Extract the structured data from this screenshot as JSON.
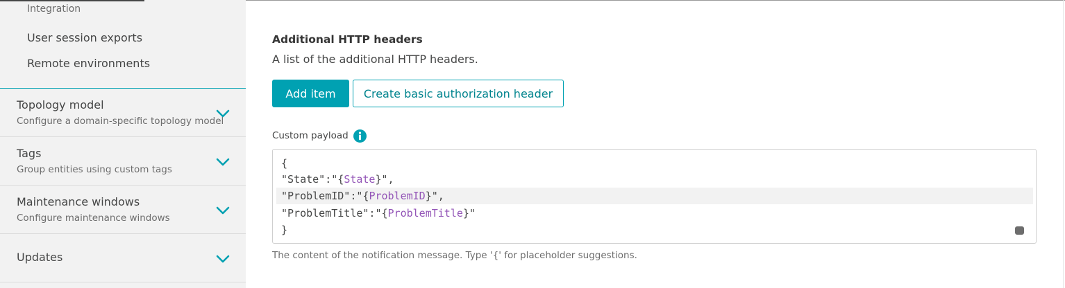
{
  "sidebar": {
    "sub_items": [
      {
        "label": "Integration"
      },
      {
        "label": "User session exports"
      },
      {
        "label": "Remote environments"
      }
    ],
    "sections": [
      {
        "title": "Topology model",
        "description": "Configure a domain-specific topology model",
        "icon": "chevron-down-icon"
      },
      {
        "title": "Tags",
        "description": "Group entities using custom tags",
        "icon": "chevron-down-icon"
      },
      {
        "title": "Maintenance windows",
        "description": "Configure maintenance windows",
        "icon": "chevron-down-icon"
      },
      {
        "title": "Updates",
        "description": "",
        "icon": "chevron-down-icon"
      }
    ]
  },
  "main": {
    "headers": {
      "title": "Additional HTTP headers",
      "description": "A list of the additional HTTP headers.",
      "add_item_label": "Add item",
      "basic_auth_label": "Create basic authorization header"
    },
    "payload": {
      "label": "Custom payload",
      "info_icon": "info-icon",
      "lines": [
        {
          "pre": "{",
          "placeholder": "",
          "post": ""
        },
        {
          "pre": "\"State\":\"{",
          "placeholder": "State",
          "post": "}\","
        },
        {
          "pre": "\"ProblemID\":\"{",
          "placeholder": "ProblemID",
          "post": "}\","
        },
        {
          "pre": "\"ProblemTitle\":\"{",
          "placeholder": "ProblemTitle",
          "post": "}\""
        },
        {
          "pre": "}",
          "placeholder": "",
          "post": ""
        }
      ],
      "active_line": 3,
      "hint": "The content of the notification message. Type '{' for placeholder suggestions."
    }
  },
  "colors": {
    "accent": "#00a1b2",
    "placeholder": "#9355b7",
    "sidebar_bg": "#f2f2f2",
    "text": "#454646"
  }
}
